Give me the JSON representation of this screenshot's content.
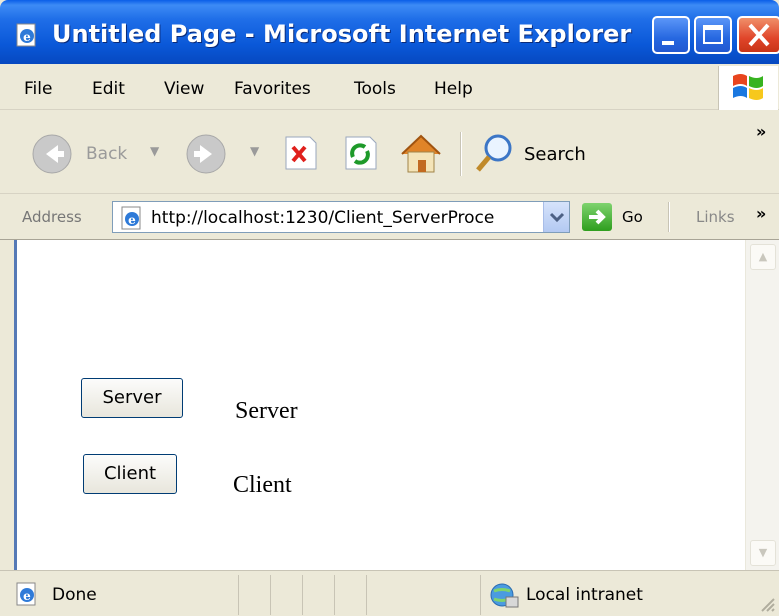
{
  "window": {
    "title": "Untitled Page - Microsoft Internet Explorer"
  },
  "menu": {
    "items": [
      "File",
      "Edit",
      "View",
      "Favorites",
      "Tools",
      "Help"
    ]
  },
  "toolbar": {
    "back_label": "Back",
    "search_label": "Search",
    "overflow": "»"
  },
  "address": {
    "label": "Address",
    "url": "http://localhost:1230/Client_ServerProce",
    "go_label": "Go",
    "links_label": "Links",
    "overflow": "»"
  },
  "page": {
    "server_button": "Server",
    "server_label": "Server",
    "client_button": "Client",
    "client_label": "Client"
  },
  "status": {
    "text": "Done",
    "zone": "Local intranet"
  },
  "colors": {
    "titlebar": "#0a58d8",
    "chrome": "#ece9d8",
    "go_green": "#2e9e1e",
    "close_red": "#e0452a"
  },
  "icons": [
    "ie-page-icon",
    "back-arrow-icon",
    "forward-arrow-icon",
    "stop-icon",
    "refresh-icon",
    "home-icon",
    "search-magnifier-icon",
    "go-arrow-icon",
    "intranet-globe-icon",
    "windows-flag-icon"
  ]
}
